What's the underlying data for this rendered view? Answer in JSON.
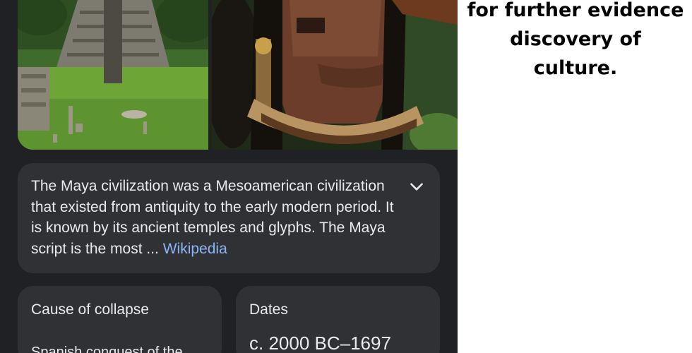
{
  "images": {
    "left_icon": "maya-pyramid-image",
    "right_icon": "maya-person-image"
  },
  "summary": {
    "text": "The Maya civilization was a Mesoamerican civilization that existed from antiquity to the early modern period. It is known by its ancient temples and glyphs. The Maya script is the most ... ",
    "link": "Wikipedia",
    "expand_icon": "chevron-down-icon"
  },
  "facts": [
    {
      "label": "Cause of collapse",
      "value": "Spanish conquest of the"
    },
    {
      "label": "Dates",
      "value": "c. 2000 BC–1697"
    }
  ],
  "caption": {
    "line1": "for further evidence",
    "line2": "discovery of",
    "line3": "culture."
  },
  "colors": {
    "background": "#202124",
    "card": "#303134",
    "text": "#e8eaed",
    "link": "#8ab4f8"
  }
}
